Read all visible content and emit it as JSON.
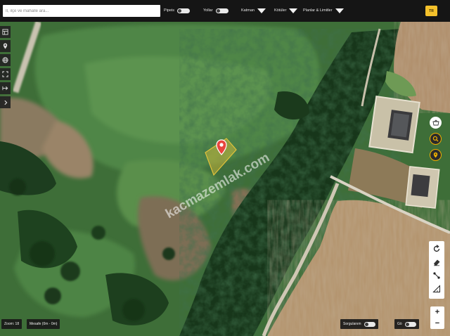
{
  "topbar": {
    "search_placeholder": "İl, ilçe ve mahalle ara...",
    "filters": [
      {
        "label": "Pipeis",
        "control": "toggle"
      },
      {
        "label": "Yollar",
        "control": "toggle"
      },
      {
        "label": "Katman",
        "control": "dropdown"
      },
      {
        "label": "Kötüler",
        "control": "dropdown"
      },
      {
        "label": "Planlar & Limitler",
        "control": "dropdown"
      }
    ],
    "lang_button": "TR"
  },
  "map": {
    "watermark": "kacmazemlak.com",
    "marker_icon": "map-pin-icon",
    "marker_color": "#e8463e",
    "parcel_color": "#e2c23a"
  },
  "left_toolbar": {
    "tools": [
      "layers-icon",
      "gps-icon",
      "globe-icon",
      "fullscreen-icon",
      "route-icon",
      "chevron-right-icon"
    ]
  },
  "right_controls": {
    "top_buttons": [
      "basket-icon",
      "search-zoom-icon",
      "location-pin-icon"
    ],
    "draw_tools": [
      "rotate-icon",
      "eraser-icon",
      "measure-icon",
      "ruler-icon"
    ],
    "zoom_in": "+",
    "zoom_out": "−"
  },
  "bottom_bar": {
    "zoom_label": "Zoom: 18",
    "distance_label": "Mesafe (0m - 0m)",
    "right_toggle_1": "Sorgulanım",
    "right_toggle_2": "Gö"
  }
}
